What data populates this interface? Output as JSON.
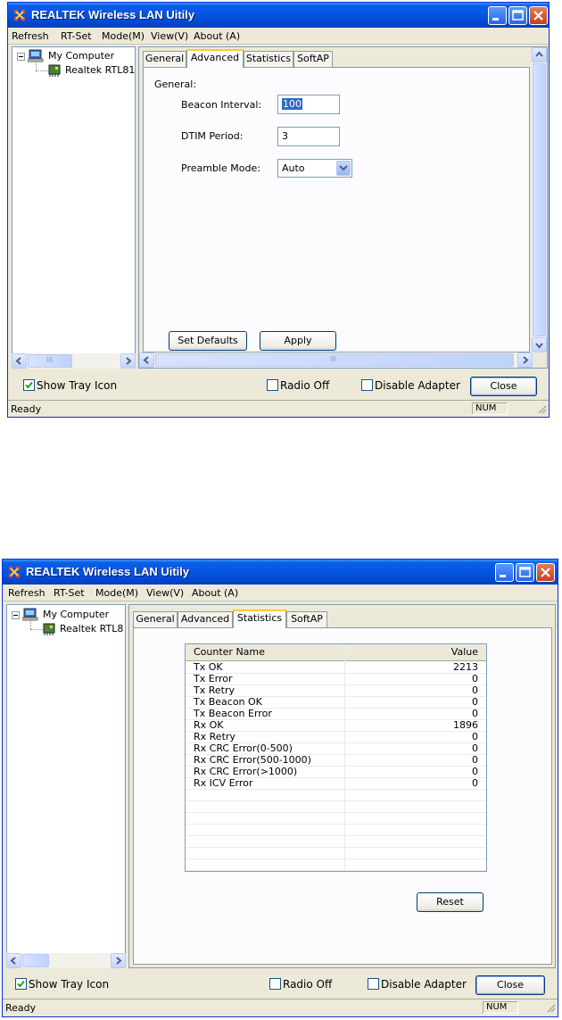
{
  "common": {
    "title": "REALTEK Wireless LAN Uitily",
    "menu": [
      "Refresh",
      "RT-Set",
      "Mode(M)",
      "View(V)",
      "About (A)"
    ],
    "tree": {
      "root": "My Computer",
      "adapter_1": "Realtek RTL81:",
      "adapter_2": "Realtek RTL8"
    },
    "tabs": [
      "General",
      "Advanced",
      "Statistics",
      "SoftAP"
    ],
    "bottom": {
      "show_tray_icon": "Show Tray Icon",
      "radio_off": "Radio Off",
      "disable_adapter": "Disable Adapter",
      "close": "Close"
    },
    "status": {
      "ready": "Ready",
      "num": "NUM"
    },
    "scroll_grip": "III"
  },
  "window1": {
    "active_tab": "Advanced",
    "section_label": "General:",
    "beacon_interval_label": "Beacon Interval:",
    "beacon_interval_value": "100",
    "dtim_period_label": "DTIM Period:",
    "dtim_period_value": "3",
    "preamble_mode_label": "Preamble Mode:",
    "preamble_mode_value": "Auto",
    "set_defaults_button": "Set Defaults",
    "apply_button": "Apply",
    "show_tray_icon_checked": true,
    "radio_off_checked": false,
    "disable_adapter_checked": false
  },
  "window2": {
    "active_tab": "Statistics",
    "columns": [
      "Counter Name",
      "Value"
    ],
    "rows": [
      {
        "name": "Tx OK",
        "value": "2213"
      },
      {
        "name": "Tx Error",
        "value": "0"
      },
      {
        "name": "Tx Retry",
        "value": "0"
      },
      {
        "name": "Tx Beacon OK",
        "value": "0"
      },
      {
        "name": "Tx Beacon Error",
        "value": "0"
      },
      {
        "name": "Rx OK",
        "value": "1896"
      },
      {
        "name": "Rx Retry",
        "value": "0"
      },
      {
        "name": "Rx CRC Error(0-500)",
        "value": "0"
      },
      {
        "name": "Rx CRC Error(500-1000)",
        "value": "0"
      },
      {
        "name": "Rx CRC Error(>1000)",
        "value": "0"
      },
      {
        "name": "Rx ICV Error",
        "value": "0"
      }
    ],
    "reset_button": "Reset",
    "show_tray_icon_checked": true,
    "radio_off_checked": false,
    "disable_adapter_checked": false
  }
}
